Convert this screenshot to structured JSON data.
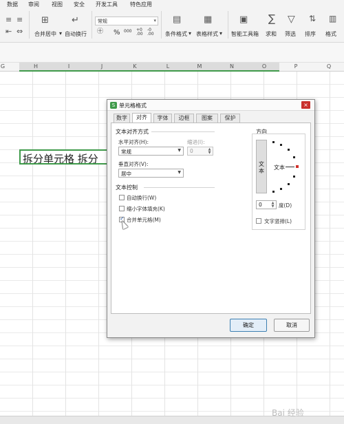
{
  "menu": [
    "数据",
    "审阅",
    "视图",
    "安全",
    "开发工具",
    "特色应用"
  ],
  "ribbon": {
    "merge_center": "合并居中",
    "auto_wrap": "自动换行",
    "number_format": "常规",
    "percent_symbol": "%",
    "thousands_symbol": "000",
    "conditional_format": "条件格式",
    "table_style": "表格样式",
    "smart_toolbox": "智能工具箱",
    "sum": "求和",
    "filter": "筛选",
    "sort": "排序",
    "format": "格式"
  },
  "columns": [
    "G",
    "H",
    "I",
    "J",
    "K",
    "L",
    "M",
    "N",
    "O",
    "P",
    "Q"
  ],
  "merged_cell_text": "拆分单元格 拆分",
  "dialog": {
    "title": "单元格格式",
    "close": "×",
    "tabs": [
      "数字",
      "对齐",
      "字体",
      "边框",
      "图案",
      "保护"
    ],
    "active_tab": "对齐",
    "text_alignment_title": "文本对齐方式",
    "horizontal_label": "水平对齐(H):",
    "horizontal_value": "常规",
    "indent_label": "缩进(I):",
    "indent_value": "0",
    "vertical_label": "垂直对齐(V):",
    "vertical_value": "居中",
    "text_control_title": "文本控制",
    "wrap_text": "自动换行(W)",
    "shrink_to_fit": "缩小字体填充(K)",
    "merge_cells": "合并单元格(M)",
    "merge_cells_checked": true,
    "orientation_title": "方向",
    "vertical_text": "文本",
    "dial_text": "文本",
    "degrees_value": "0",
    "degrees_label": "度(D)",
    "vertical_layout": "文字竖排(L)",
    "ok": "确定",
    "cancel": "取消"
  },
  "watermark": "Bai 经验",
  "colors": {
    "accent_green": "#3f9a4a",
    "close_red": "#c9302c"
  }
}
